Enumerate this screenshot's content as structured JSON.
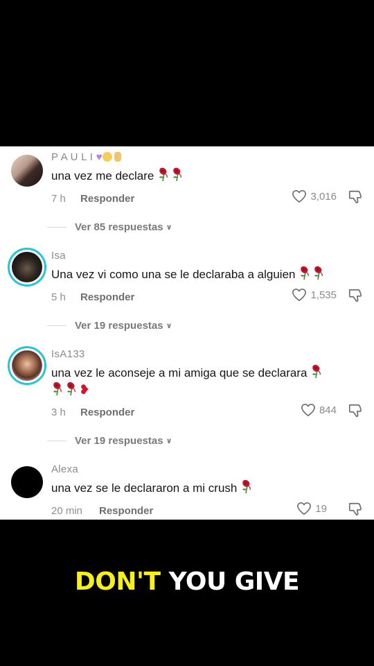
{
  "comments": [
    {
      "username": "P A U L I",
      "text": "una vez me declare",
      "time": "7 h",
      "reply_label": "Responder",
      "likes": "3,016",
      "view_replies": "Ver 85 respuestas"
    },
    {
      "username": "Isa",
      "text": "Una vez vi como una se le declaraba a alguien",
      "time": "5 h",
      "reply_label": "Responder",
      "likes": "1,535",
      "view_replies": "Ver 19 respuestas"
    },
    {
      "username": "IsA133",
      "text": "una vez le aconseje a mi amiga que se declarara",
      "time": "3 h",
      "reply_label": "Responder",
      "likes": "844",
      "view_replies": "Ver 19 respuestas"
    },
    {
      "username": "Alexa",
      "text": "una vez se le declararon a mi crush",
      "time": "20 min",
      "reply_label": "Responder",
      "likes": "19"
    }
  ],
  "caption": {
    "part1": "DON'T",
    "part2": "YOU GIVE",
    "highlight_color": "#f7ef1a"
  },
  "icons": [
    "purple-heart-icon",
    "flushed-face-icon",
    "hand-icon",
    "wilted-rose-icon",
    "broken-heart-icon",
    "heart-icon",
    "dislike-icon",
    "chevron-down-icon"
  ]
}
